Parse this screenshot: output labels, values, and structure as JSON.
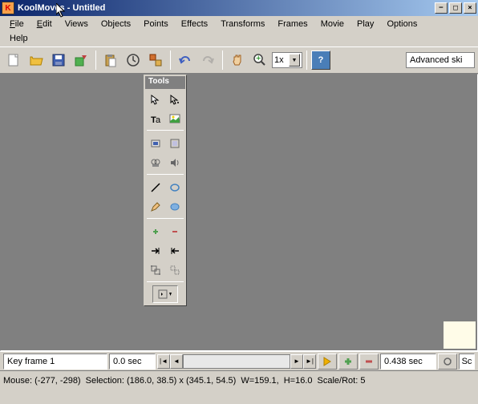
{
  "title": "KoolMoves - Untitled",
  "menu": {
    "file": "File",
    "edit": "Edit",
    "views": "Views",
    "objects": "Objects",
    "points": "Points",
    "effects": "Effects",
    "transforms": "Transforms",
    "frames": "Frames",
    "movie": "Movie",
    "play": "Play",
    "options": "Options",
    "help": "Help"
  },
  "toolbar": {
    "zoom_value": "1x",
    "skill_label": "Advanced ski"
  },
  "tools": {
    "title": "Tools"
  },
  "bottom": {
    "keyframe_label": "Key frame 1",
    "sec_label": "0.0 sec",
    "total_sec": "0.438 sec",
    "end_label": "Sc"
  },
  "status": {
    "mouse": "Mouse: (-277, -298)",
    "selection": "Selection: (186.0, 38.5) x (345.1, 54.5)",
    "width": "W=159.1,",
    "height": "H=16.0",
    "scale": "Scale/Rot: 5"
  }
}
